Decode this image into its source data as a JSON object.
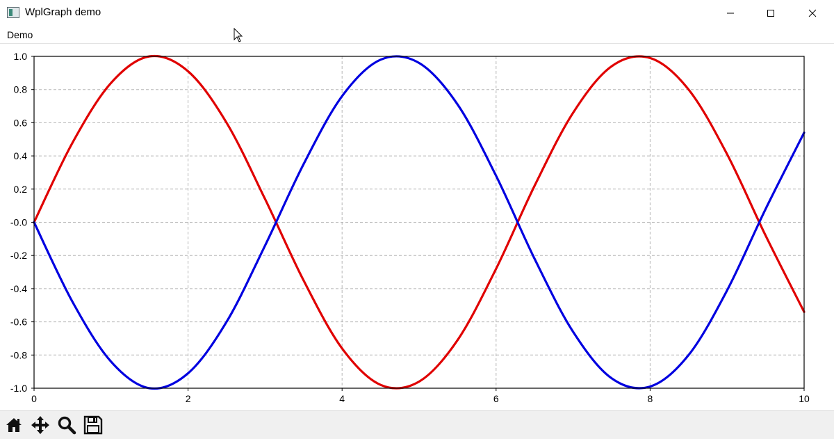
{
  "window": {
    "title": "WplGraph demo",
    "controls": [
      "minimize-icon",
      "maximize-icon",
      "close-icon"
    ]
  },
  "menu": {
    "items": [
      "Demo"
    ]
  },
  "toolbar": {
    "icons": [
      "home-icon",
      "pan-icon",
      "zoom-icon",
      "save-icon"
    ]
  },
  "chart_data": {
    "type": "line",
    "title": "",
    "xlabel": "",
    "ylabel": "",
    "xlim": [
      0,
      10
    ],
    "ylim": [
      -1.0,
      1.0
    ],
    "grid": true,
    "x_ticks": [
      "0",
      "2",
      "4",
      "6",
      "8",
      "10"
    ],
    "y_ticks": [
      "-1.0",
      "-0.8",
      "-0.6",
      "-0.4",
      "-0.2",
      "-0.0",
      "0.2",
      "0.4",
      "0.6",
      "0.8",
      "1.0"
    ],
    "series": [
      {
        "color": "#e00000",
        "x": [
          0,
          0.5,
          1,
          1.5,
          2,
          2.5,
          3,
          3.5,
          4,
          4.5,
          5,
          5.5,
          6,
          6.5,
          7,
          7.5,
          8,
          8.5,
          9,
          9.5,
          10
        ],
        "values": [
          0,
          0.48,
          0.84,
          1.0,
          0.91,
          0.6,
          0.14,
          -0.35,
          -0.76,
          -0.98,
          -0.96,
          -0.71,
          -0.28,
          0.22,
          0.66,
          0.94,
          0.99,
          0.8,
          0.41,
          -0.08,
          -0.54
        ]
      },
      {
        "color": "#0000e0",
        "x": [
          0,
          0.5,
          1,
          1.5,
          2,
          2.5,
          3,
          3.5,
          4,
          4.5,
          5,
          5.5,
          6,
          6.5,
          7,
          7.5,
          8,
          8.5,
          9,
          9.5,
          10
        ],
        "values": [
          0,
          -0.48,
          -0.84,
          -1.0,
          -0.91,
          -0.6,
          -0.14,
          0.35,
          0.76,
          0.98,
          0.96,
          0.71,
          0.28,
          -0.22,
          -0.66,
          -0.94,
          -0.99,
          -0.8,
          -0.41,
          0.08,
          0.54
        ]
      }
    ]
  }
}
